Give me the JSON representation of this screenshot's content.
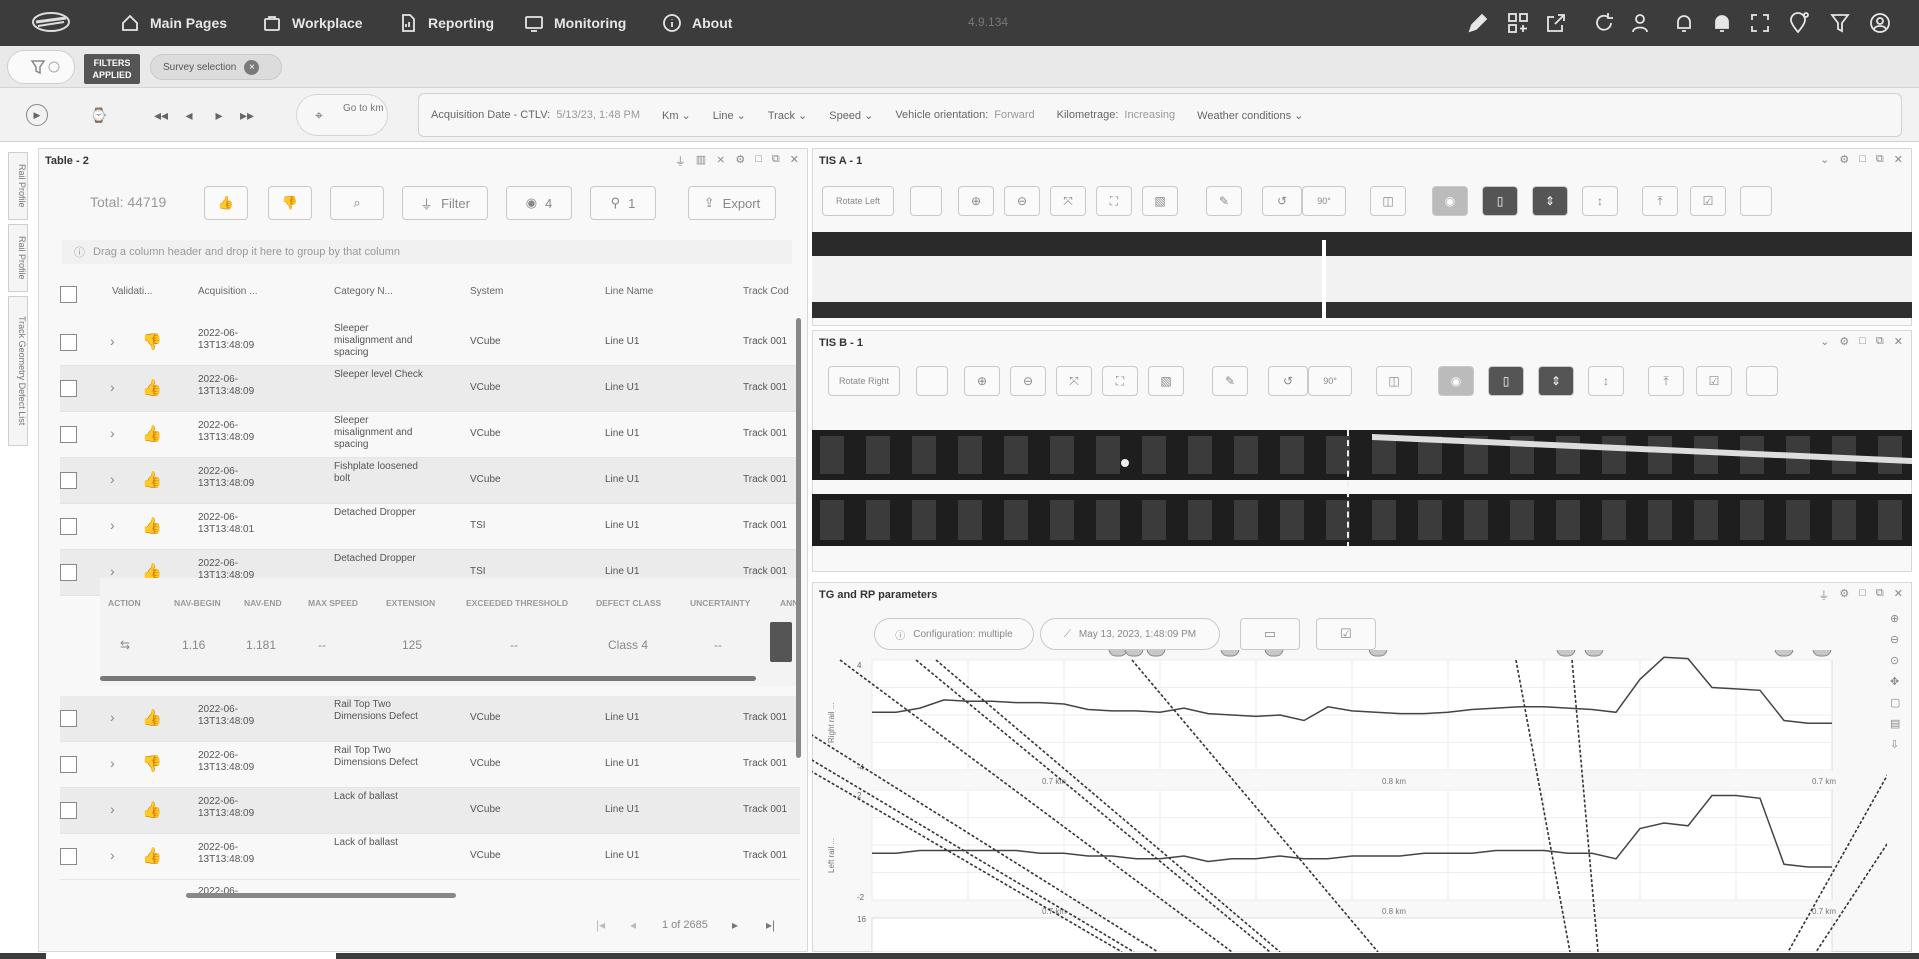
{
  "topbar": {
    "nav": [
      "Main Pages",
      "Workplace",
      "Reporting",
      "Monitoring",
      "About"
    ],
    "version": "4.9.134"
  },
  "filterbar": {
    "filters_applied": "FILTERS APPLIED",
    "survey_chip": "Survey selection"
  },
  "playbar": {
    "goto_label": "Go to km",
    "acq_label": "Acquisition Date - CTLV:",
    "acq_value": "5/13/23, 1:48 PM",
    "km": "Km",
    "line": "Line",
    "track": "Track",
    "speed": "Speed",
    "vo_label": "Vehicle orientation:",
    "vo_value": "Forward",
    "kilo_label": "Kilometrage:",
    "kilo_value": "Increasing",
    "weather": "Weather conditions"
  },
  "vtabs": [
    "Rail Profile",
    "Rail Profile",
    "Track Geometry Defect List"
  ],
  "table_panel": {
    "title": "Table - 2",
    "total": "Total: 44719",
    "filter": "Filter",
    "eye_count": "4",
    "pin_count": "1",
    "export": "Export",
    "group_hint": "Drag a column header and drop it here to group by that column",
    "headers": [
      "Validati...",
      "Acquisition ...",
      "Category N...",
      "System",
      "Line Name",
      "Track Cod"
    ],
    "rows": [
      {
        "dt": "2022-06-13T13:48:09",
        "cat": "Sleeper misalignment and spacing",
        "sys": "VCube",
        "line": "Line U1",
        "trk": "Track 001",
        "thumb": "down",
        "alt": false
      },
      {
        "dt": "2022-06-13T13:48:09",
        "cat": "Sleeper level Check",
        "sys": "VCube",
        "line": "Line U1",
        "trk": "Track 001",
        "thumb": "up",
        "alt": true
      },
      {
        "dt": "2022-06-13T13:48:09",
        "cat": "Sleeper misalignment and spacing",
        "sys": "VCube",
        "line": "Line U1",
        "trk": "Track 001",
        "thumb": "up",
        "alt": false
      },
      {
        "dt": "2022-06-13T13:48:09",
        "cat": "Fishplate loosened bolt",
        "sys": "VCube",
        "line": "Line U1",
        "trk": "Track 001",
        "thumb": "up",
        "alt": true
      },
      {
        "dt": "2022-06-13T13:48:01",
        "cat": "Detached Dropper",
        "sys": "TSI",
        "line": "Line U1",
        "trk": "Track 001",
        "thumb": "up",
        "alt": false
      },
      {
        "dt": "2022-06-13T13:48:09",
        "cat": "Detached Dropper",
        "sys": "TSI",
        "line": "Line U1",
        "trk": "Track 001",
        "thumb": "up",
        "alt": true
      }
    ],
    "rows2": [
      {
        "dt": "2022-06-13T13:48:09",
        "cat": "Rail Top Two Dimensions Defect",
        "sys": "VCube",
        "line": "Line U1",
        "trk": "Track 001",
        "thumb": "up",
        "alt": true
      },
      {
        "dt": "2022-06-13T13:48:09",
        "cat": "Rail Top Two Dimensions Defect",
        "sys": "VCube",
        "line": "Line U1",
        "trk": "Track 001",
        "thumb": "down",
        "alt": false
      },
      {
        "dt": "2022-06-13T13:48:09",
        "cat": "Lack of ballast",
        "sys": "VCube",
        "line": "Line U1",
        "trk": "Track 001",
        "thumb": "up",
        "alt": true
      },
      {
        "dt": "2022-06-13T13:48:09",
        "cat": "Lack of ballast",
        "sys": "VCube",
        "line": "Line U1",
        "trk": "Track 001",
        "thumb": "up",
        "alt": false
      }
    ],
    "detail_headers": [
      "ACTION",
      "NAV-BEGIN",
      "NAV-END",
      "MAX SPEED",
      "EXTENSION",
      "EXCEEDED THRESHOLD",
      "DEFECT CLASS",
      "UNCERTAINTY",
      "ANN"
    ],
    "detail_values": [
      "",
      "1.16",
      "1.181",
      "--",
      "125",
      "--",
      "Class 4",
      "--"
    ],
    "pagination": "1 of 2685",
    "last_row_dt": "2022-06-"
  },
  "tia_panel": {
    "title": "TIS A - 1",
    "rotate": "Rotate Left",
    "deg": "90°"
  },
  "tib_panel": {
    "title": "TIS B - 1",
    "rotate": "Rotate Right",
    "deg": "90°"
  },
  "chart_panel": {
    "title": "TG and RP parameters",
    "config": "Configuration: multiple",
    "date": "May 13, 2023, 1:48:09 PM",
    "yl1": "Right rail ...",
    "yl2": "Left rail ...",
    "xticks": [
      "0.7 km",
      "0.8 km",
      "0.7 km"
    ],
    "yticks1": [
      "4",
      "-4"
    ],
    "yticks2": [
      "2",
      "-2"
    ],
    "ytick3": "16"
  },
  "chart_data": [
    {
      "type": "line",
      "title": "",
      "xlabel": "",
      "ylabel": "Right rail ...",
      "ylim": [
        -4,
        4
      ],
      "x": [
        0,
        1,
        2,
        3,
        4,
        5,
        6,
        7,
        8,
        9,
        10,
        11,
        12,
        13,
        14,
        15,
        16,
        17,
        18,
        19,
        20,
        21,
        22,
        23,
        24,
        25,
        26,
        27,
        28,
        29,
        30,
        31,
        32,
        33,
        34,
        35,
        36,
        37,
        38,
        39,
        40
      ],
      "series": [
        {
          "values": [
            0.2,
            0.2,
            0.5,
            1.1,
            1.0,
            1.0,
            0.9,
            0.9,
            0.8,
            0.4,
            0.3,
            0.3,
            0.2,
            0.5,
            0.1,
            0.0,
            -0.1,
            0.0,
            -0.4,
            0.6,
            0.3,
            0.2,
            0.1,
            0.1,
            0.2,
            0.4,
            0.5,
            0.6,
            0.6,
            0.5,
            0.4,
            0.2,
            2.6,
            4.2,
            4.1,
            2.0,
            1.9,
            1.8,
            -0.4,
            -0.6,
            -0.6
          ]
        }
      ]
    },
    {
      "type": "line",
      "title": "",
      "xlabel": "",
      "ylabel": "Left rail ...",
      "ylim": [
        -2,
        2
      ],
      "x": [
        0,
        1,
        2,
        3,
        4,
        5,
        6,
        7,
        8,
        9,
        10,
        11,
        12,
        13,
        14,
        15,
        16,
        17,
        18,
        19,
        20,
        21,
        22,
        23,
        24,
        25,
        26,
        27,
        28,
        29,
        30,
        31,
        32,
        33,
        34,
        35,
        36,
        37,
        38,
        39,
        40
      ],
      "series": [
        {
          "values": [
            -0.3,
            -0.3,
            -0.2,
            -0.2,
            -0.2,
            -0.2,
            -0.2,
            -0.3,
            -0.3,
            -0.4,
            -0.4,
            -0.5,
            -0.5,
            -0.4,
            -0.6,
            -0.5,
            -0.5,
            -0.4,
            -0.5,
            -0.5,
            -0.4,
            -0.4,
            -0.4,
            -0.3,
            -0.3,
            -0.3,
            -0.2,
            -0.2,
            -0.2,
            -0.3,
            -0.3,
            -0.5,
            0.6,
            0.8,
            0.7,
            1.8,
            1.8,
            1.7,
            -0.7,
            -0.8,
            -0.8
          ]
        }
      ]
    }
  ]
}
